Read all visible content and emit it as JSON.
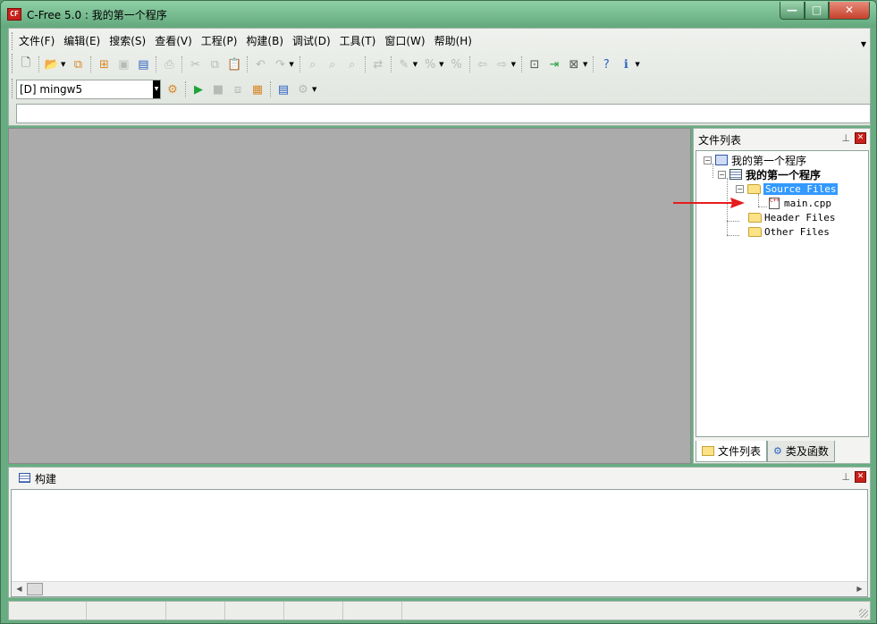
{
  "window": {
    "title": "C-Free 5.0 : 我的第一个程序",
    "app_icon_text": "CF",
    "controls": {
      "minimize": "—",
      "maximize": "□",
      "close": "✕"
    }
  },
  "menubar": {
    "items": [
      {
        "label": "文件(F)"
      },
      {
        "label": "编辑(E)"
      },
      {
        "label": "搜索(S)"
      },
      {
        "label": "查看(V)"
      },
      {
        "label": "工程(P)"
      },
      {
        "label": "构建(B)"
      },
      {
        "label": "调试(D)"
      },
      {
        "label": "工具(T)"
      },
      {
        "label": "窗口(W)"
      },
      {
        "label": "帮助(H)"
      }
    ]
  },
  "toolbar": {
    "compiler_value": "[D] mingw5",
    "command_value": ""
  },
  "file_panel": {
    "title": "文件列表",
    "tree": {
      "workspace": "我的第一个程序",
      "project": "我的第一个程序",
      "source_folder": "Source Files",
      "source_file": "main.cpp",
      "header_folder": "Header Files",
      "other_folder": "Other Files"
    },
    "tabs": [
      {
        "label": "文件列表"
      },
      {
        "label": "类及函数"
      }
    ]
  },
  "build_panel": {
    "title": "构建"
  },
  "colors": {
    "title_bar": "#68ad82",
    "editor_background": "#ababab",
    "selection": "#3399ff",
    "annotation_arrow": "#e51c1c"
  }
}
